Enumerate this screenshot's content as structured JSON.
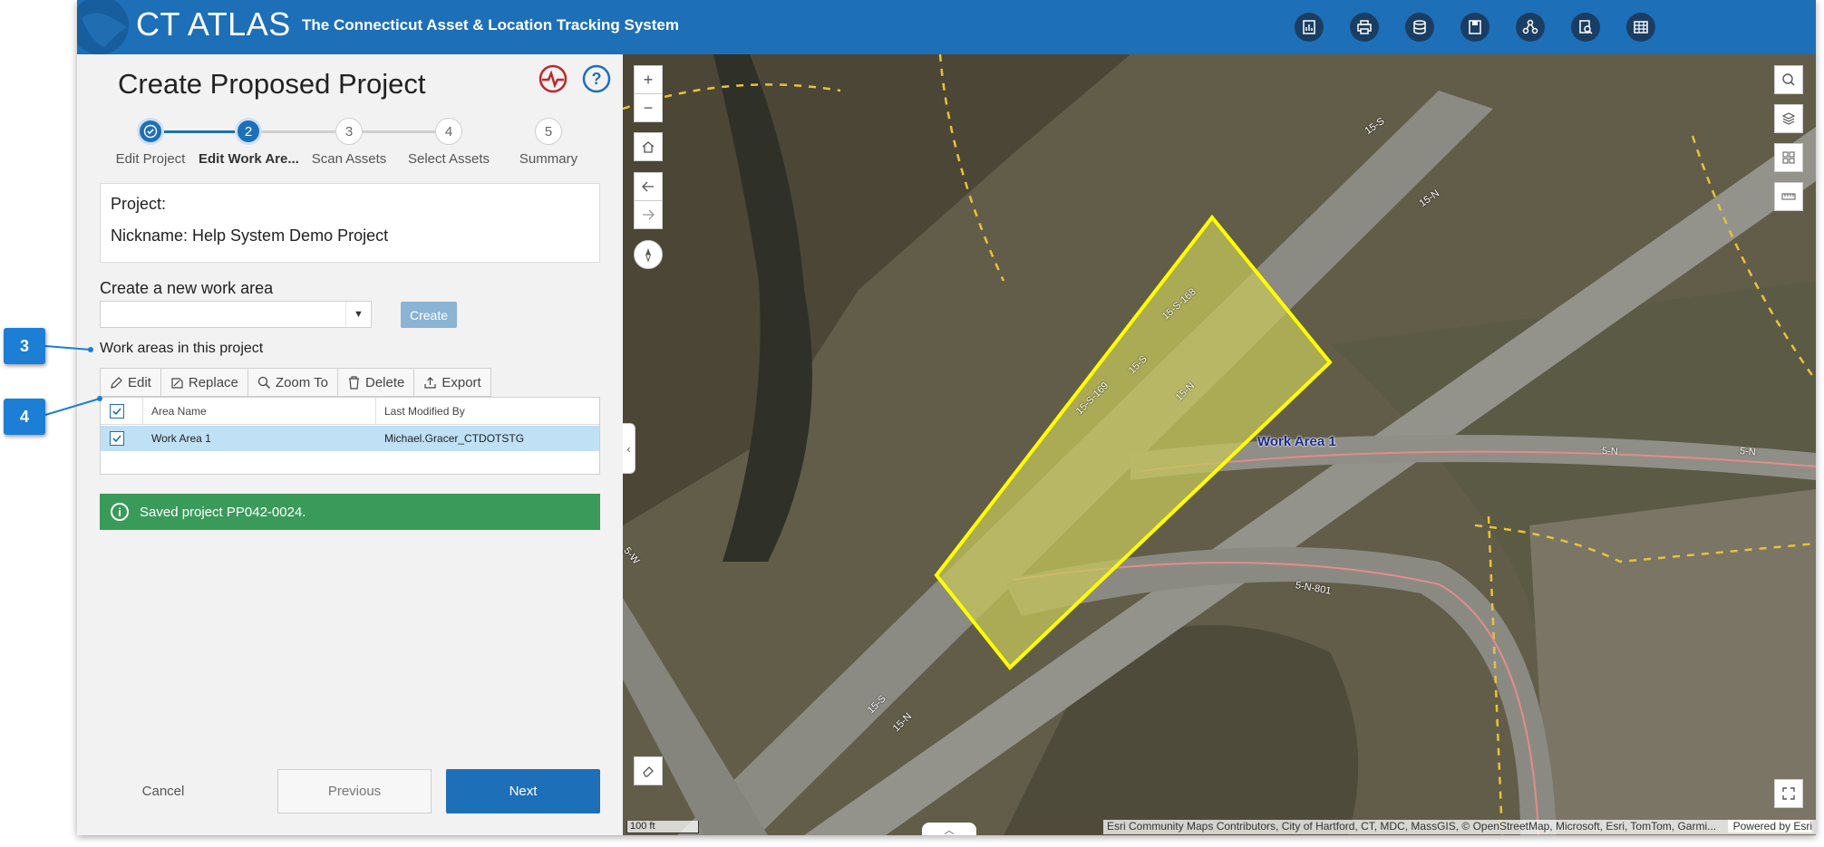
{
  "header": {
    "app_title": "CT ATLAS",
    "app_subtitle": "The Connecticut Asset & Location Tracking System",
    "buttons": [
      {
        "name": "report-icon"
      },
      {
        "name": "print-icon"
      },
      {
        "name": "database-icon"
      },
      {
        "name": "save-icon"
      },
      {
        "name": "network-icon"
      },
      {
        "name": "search-document-icon"
      },
      {
        "name": "table-icon"
      }
    ]
  },
  "panel": {
    "title": "Create Proposed Project",
    "steps": [
      {
        "number": "",
        "label": "Edit Project",
        "state": "done"
      },
      {
        "number": "2",
        "label": "Edit Work Are...",
        "state": "active"
      },
      {
        "number": "3",
        "label": "Scan Assets",
        "state": "pending"
      },
      {
        "number": "4",
        "label": "Select Assets",
        "state": "pending"
      },
      {
        "number": "5",
        "label": "Summary",
        "state": "pending"
      }
    ],
    "project_label": "Project:",
    "nickname": "Nickname: Help System Demo Project",
    "new_area_label": "Create a new work area",
    "combo_value": "",
    "create_label": "Create",
    "work_areas_label": "Work areas in this project",
    "toolbar": {
      "edit": "Edit",
      "replace": "Replace",
      "zoom_to": "Zoom To",
      "delete": "Delete",
      "export": "Export"
    },
    "table": {
      "columns": [
        "Area Name",
        "Last Modified By"
      ],
      "rows": [
        {
          "area_name": "Work Area 1",
          "modified_by": "Michael.Gracer_CTDOTSTG"
        }
      ]
    },
    "toast": "Saved project PP042-0024.",
    "footer": {
      "cancel": "Cancel",
      "previous": "Previous",
      "next": "Next"
    }
  },
  "map": {
    "work_area_label": "Work Area 1",
    "scale": "100 ft",
    "attribution": "Esri Community Maps Contributors, City of Hartford, CT, MDC, MassGIS, © OpenStreetMap, Microsoft, Esri, TomTom, Garmi...",
    "powered": "Powered by Esri",
    "road_labels": [
      "15-S",
      "15-N",
      "15-S-168",
      "5-N",
      "5-N-801",
      "5-W",
      "15-S",
      "15-N",
      "15-S-169",
      "15-S",
      "15-N",
      "5-N"
    ]
  },
  "callouts": [
    "3",
    "4"
  ],
  "colors": {
    "brand_blue": "#1d6fb8",
    "success_green": "#3a9a5a",
    "work_area_fill": "#c8c85a",
    "work_area_stroke": "#ffff00"
  }
}
